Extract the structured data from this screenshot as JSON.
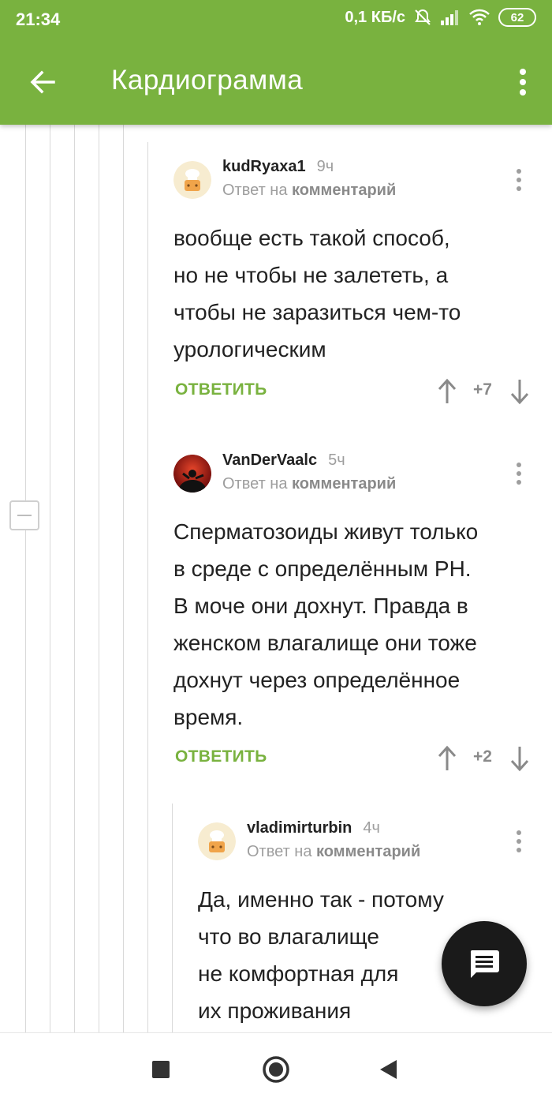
{
  "status_bar": {
    "time": "21:34",
    "net_speed": "0,1 КБ/с",
    "battery": "62",
    "icons": [
      "mute-icon",
      "signal-icon",
      "wifi-icon",
      "battery-icon"
    ]
  },
  "app_bar": {
    "title": "Кардиограмма",
    "back_icon": "arrow-left-icon",
    "menu_icon": "more-vert-icon"
  },
  "colors": {
    "accent": "#79b23f",
    "text": "#222222",
    "muted": "#9e9e9e",
    "fab": "#1a1a1a"
  },
  "comments": [
    {
      "author": "kudRyaxa1",
      "time": "9ч",
      "reply_prefix": "Ответ на",
      "reply_target": "комментарий",
      "lines": [
        "вообще есть такой способ,",
        "но не чтобы не залететь, а",
        "чтобы не заразиться чем-то",
        "урологическим"
      ],
      "reply_label": "ОТВЕТИТЬ",
      "votes": "+7"
    },
    {
      "author": "VanDerVaalc",
      "time": "5ч",
      "reply_prefix": "Ответ на",
      "reply_target": "комментарий",
      "lines": [
        "Сперматозоиды живут только",
        "в среде с определённым РН.",
        "В моче они дохнут. Правда в",
        "женском влагалище они тоже",
        "дохнут через определённое",
        "время."
      ],
      "reply_label": "ОТВЕТИТЬ",
      "votes": "+2"
    },
    {
      "author": "vladimirturbin",
      "time": "4ч",
      "reply_prefix": "Ответ на",
      "reply_target": "комментарий",
      "lines": [
        "Да, именно так - потому",
        "что во влагалище",
        "не комфортная для",
        "их проживания"
      ]
    }
  ],
  "fab_icon": "comment-icon",
  "nav": {
    "recents_icon": "square-icon",
    "home_icon": "circle-icon",
    "back_icon": "triangle-back-icon"
  }
}
